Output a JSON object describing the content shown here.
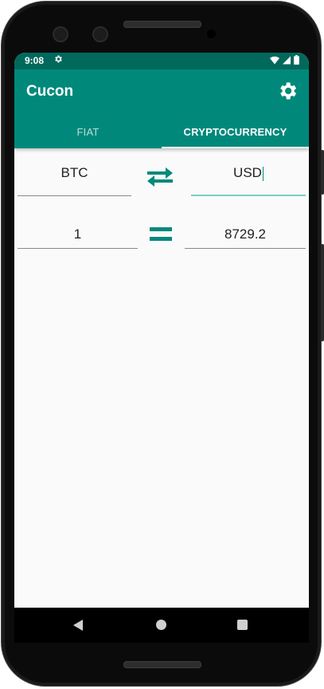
{
  "status": {
    "time": "9:08",
    "settings_icon": "gear-icon",
    "icons": [
      "wifi-icon",
      "signal-icon",
      "battery-icon"
    ]
  },
  "appbar": {
    "title": "Cucon",
    "action_icon": "settings-gear-icon"
  },
  "tabs": [
    {
      "label": "FIAT",
      "selected": false
    },
    {
      "label": "CRYPTOCURRENCY",
      "selected": true
    }
  ],
  "converter": {
    "from_currency": "BTC",
    "to_currency": "USD",
    "swap_icon": "swap-arrows-icon",
    "amount": "1",
    "equals_icon": "equals-icon",
    "result": "8729.2"
  },
  "navbar": {
    "icons": [
      "back-icon",
      "home-icon",
      "recents-icon"
    ]
  },
  "colors": {
    "primary": "#00897b",
    "primary_dark": "#00695c",
    "background": "#fafafa"
  }
}
